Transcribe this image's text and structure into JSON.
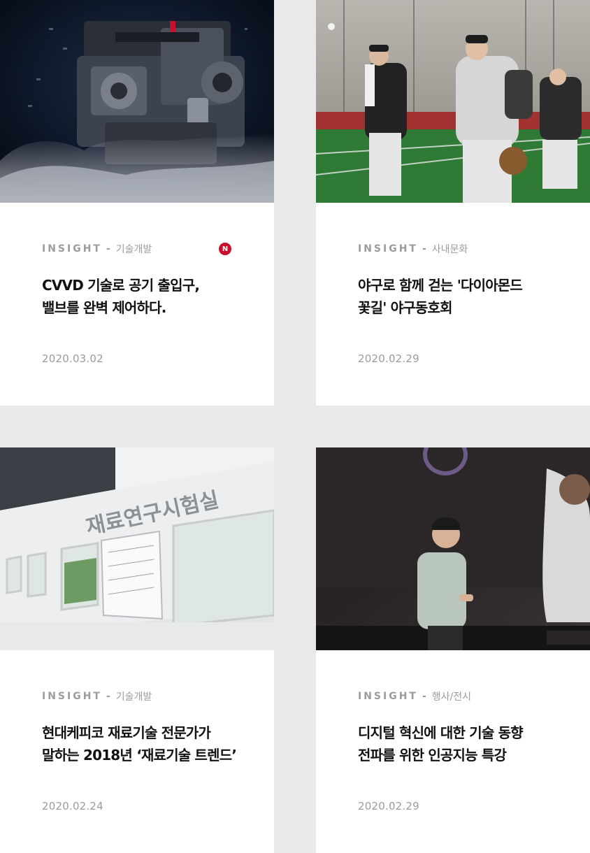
{
  "cards": [
    {
      "kicker": "INSIGHT",
      "separator": "-",
      "category": "기술개발",
      "badge": "N",
      "title_line1": "CVVD 기술로 공기 출입구,",
      "title_line2": "밸브를 완벽 제어하다.",
      "date": "2020.03.02",
      "image": "engine-photo"
    },
    {
      "kicker": "INSIGHT",
      "separator": "-",
      "category": "사내문화",
      "title_line1": "야구로 함께 걷는 '다이아몬드",
      "title_line2": "꽃길' 야구동호회",
      "date": "2020.02.29",
      "image": "baseball-club-photo"
    },
    {
      "kicker": "INSIGHT",
      "separator": "-",
      "category": "기술개발",
      "title_line1": "현대케피코 재료기술 전문가가",
      "title_line2": "말하는 2018년 ‘재료기술 트렌드’",
      "date": "2020.02.24",
      "image": "materials-lab-photo",
      "image_text": "재료연구시험실"
    },
    {
      "kicker": "INSIGHT",
      "separator": "-",
      "category": "행사/전시",
      "title_line1": "디지털 혁신에 대한 기술 동향",
      "title_line2": "전파를 위한 인공지능 특강",
      "date": "2020.02.29",
      "image": "lecture-speaker-photo"
    }
  ],
  "colors": {
    "background": "#e9e9e9",
    "card": "#ffffff",
    "muted": "#9b9b9b",
    "title": "#111111",
    "badge": "#c8102e"
  }
}
